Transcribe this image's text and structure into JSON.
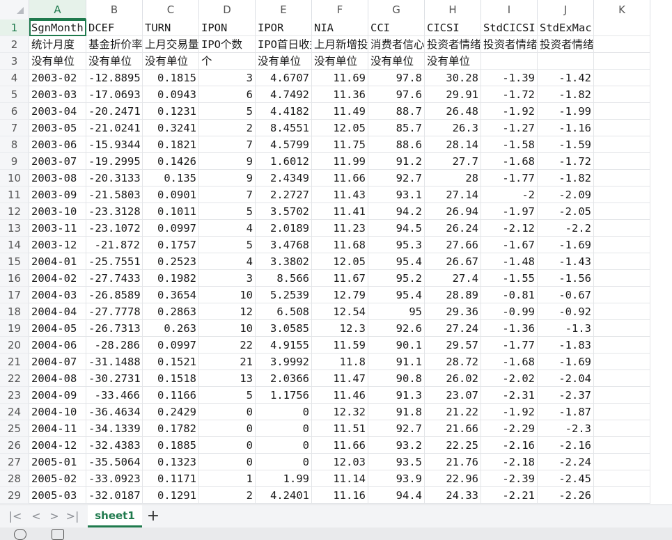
{
  "columns": [
    "A",
    "B",
    "C",
    "D",
    "E",
    "F",
    "G",
    "H",
    "I",
    "J",
    "K"
  ],
  "rows": [
    {
      "n": "1",
      "c": [
        "SgnMonth",
        "DCEF",
        "TURN",
        "IPON",
        "IPOR",
        "NIA",
        "CCI",
        "CICSI",
        "StdCICSI",
        "StdExMacroCICSI",
        ""
      ]
    },
    {
      "n": "2",
      "c": [
        "统计月度",
        "基金折价率",
        "上月交易量",
        "IPO个数",
        "IPO首日收益",
        "上月新增投资",
        "消费者信心指数",
        "投资者情绪",
        "投资者情绪",
        "投资者情绪指数(标准化",
        ""
      ]
    },
    {
      "n": "3",
      "c": [
        "没有单位",
        "没有单位",
        "没有单位",
        "个",
        "没有单位",
        "没有单位",
        "没有单位",
        "没有单位",
        "",
        "",
        ""
      ]
    },
    {
      "n": "4",
      "c": [
        "2003-02",
        "-12.8895",
        "0.1815",
        "3",
        "4.6707",
        "11.69",
        "97.8",
        "30.28",
        "-1.39",
        "-1.42",
        ""
      ]
    },
    {
      "n": "5",
      "c": [
        "2003-03",
        "-17.0693",
        "0.0943",
        "6",
        "4.7492",
        "11.36",
        "97.6",
        "29.91",
        "-1.72",
        "-1.82",
        ""
      ]
    },
    {
      "n": "6",
      "c": [
        "2003-04",
        "-20.2471",
        "0.1231",
        "5",
        "4.4182",
        "11.49",
        "88.7",
        "26.48",
        "-1.92",
        "-1.99",
        ""
      ]
    },
    {
      "n": "7",
      "c": [
        "2003-05",
        "-21.0241",
        "0.3241",
        "2",
        "8.4551",
        "12.05",
        "85.7",
        "26.3",
        "-1.27",
        "-1.16",
        ""
      ]
    },
    {
      "n": "8",
      "c": [
        "2003-06",
        "-15.9344",
        "0.1821",
        "7",
        "4.5799",
        "11.75",
        "88.6",
        "28.14",
        "-1.58",
        "-1.59",
        ""
      ]
    },
    {
      "n": "9",
      "c": [
        "2003-07",
        "-19.2995",
        "0.1426",
        "9",
        "1.6012",
        "11.99",
        "91.2",
        "27.7",
        "-1.68",
        "-1.72",
        ""
      ]
    },
    {
      "n": "10",
      "c": [
        "2003-08",
        "-20.3133",
        "0.135",
        "9",
        "2.4349",
        "11.66",
        "92.7",
        "28",
        "-1.77",
        "-1.82",
        ""
      ]
    },
    {
      "n": "11",
      "c": [
        "2003-09",
        "-21.5803",
        "0.0901",
        "7",
        "2.2727",
        "11.43",
        "93.1",
        "27.14",
        "-2",
        "-2.09",
        ""
      ]
    },
    {
      "n": "12",
      "c": [
        "2003-10",
        "-23.3128",
        "0.1011",
        "5",
        "3.5702",
        "11.41",
        "94.2",
        "26.94",
        "-1.97",
        "-2.05",
        ""
      ]
    },
    {
      "n": "13",
      "c": [
        "2003-11",
        "-23.1072",
        "0.0997",
        "4",
        "2.0189",
        "11.23",
        "94.5",
        "26.24",
        "-2.12",
        "-2.2",
        ""
      ]
    },
    {
      "n": "14",
      "c": [
        "2003-12",
        "-21.872",
        "0.1757",
        "5",
        "3.4768",
        "11.68",
        "95.3",
        "27.66",
        "-1.67",
        "-1.69",
        ""
      ]
    },
    {
      "n": "15",
      "c": [
        "2004-01",
        "-25.7551",
        "0.2523",
        "4",
        "3.3802",
        "12.05",
        "95.4",
        "26.67",
        "-1.48",
        "-1.43",
        ""
      ]
    },
    {
      "n": "16",
      "c": [
        "2004-02",
        "-27.7433",
        "0.1982",
        "3",
        "8.566",
        "11.67",
        "95.2",
        "27.4",
        "-1.55",
        "-1.56",
        ""
      ]
    },
    {
      "n": "17",
      "c": [
        "2004-03",
        "-26.8589",
        "0.3654",
        "10",
        "5.2539",
        "12.79",
        "95.4",
        "28.89",
        "-0.81",
        "-0.67",
        ""
      ]
    },
    {
      "n": "18",
      "c": [
        "2004-04",
        "-27.7778",
        "0.2863",
        "12",
        "6.508",
        "12.54",
        "95",
        "29.36",
        "-0.99",
        "-0.92",
        ""
      ]
    },
    {
      "n": "19",
      "c": [
        "2004-05",
        "-26.7313",
        "0.263",
        "10",
        "3.0585",
        "12.3",
        "92.6",
        "27.24",
        "-1.36",
        "-1.3",
        ""
      ]
    },
    {
      "n": "20",
      "c": [
        "2004-06",
        "-28.286",
        "0.0997",
        "22",
        "4.9155",
        "11.59",
        "90.1",
        "29.57",
        "-1.77",
        "-1.83",
        ""
      ]
    },
    {
      "n": "21",
      "c": [
        "2004-07",
        "-31.1488",
        "0.1521",
        "21",
        "3.9992",
        "11.8",
        "91.1",
        "28.72",
        "-1.68",
        "-1.69",
        ""
      ]
    },
    {
      "n": "22",
      "c": [
        "2004-08",
        "-30.2731",
        "0.1518",
        "13",
        "2.0366",
        "11.47",
        "90.8",
        "26.02",
        "-2.02",
        "-2.04",
        ""
      ]
    },
    {
      "n": "23",
      "c": [
        "2004-09",
        "-33.466",
        "0.1166",
        "5",
        "1.1756",
        "11.46",
        "91.3",
        "23.07",
        "-2.31",
        "-2.37",
        ""
      ]
    },
    {
      "n": "24",
      "c": [
        "2004-10",
        "-36.4634",
        "0.2429",
        "0",
        "0",
        "12.32",
        "91.8",
        "21.22",
        "-1.92",
        "-1.87",
        ""
      ]
    },
    {
      "n": "25",
      "c": [
        "2004-11",
        "-34.1339",
        "0.1782",
        "0",
        "0",
        "11.51",
        "92.7",
        "21.66",
        "-2.29",
        "-2.3",
        ""
      ]
    },
    {
      "n": "26",
      "c": [
        "2004-12",
        "-32.4383",
        "0.1885",
        "0",
        "0",
        "11.66",
        "93.2",
        "22.25",
        "-2.16",
        "-2.16",
        ""
      ]
    },
    {
      "n": "27",
      "c": [
        "2005-01",
        "-35.5064",
        "0.1323",
        "0",
        "0",
        "12.03",
        "93.5",
        "21.76",
        "-2.18",
        "-2.24",
        ""
      ]
    },
    {
      "n": "28",
      "c": [
        "2005-02",
        "-33.0923",
        "0.1171",
        "1",
        "1.99",
        "11.14",
        "93.9",
        "22.96",
        "-2.39",
        "-2.45",
        ""
      ]
    },
    {
      "n": "29",
      "c": [
        "2005-03",
        "-32.0187",
        "0.1291",
        "2",
        "4.2401",
        "11.16",
        "94.4",
        "24.33",
        "-2.21",
        "-2.26",
        ""
      ]
    }
  ],
  "sheet_tab": "sheet1",
  "add_tab": "+",
  "nav": {
    "first": "|<",
    "prev": "<",
    "next": ">",
    "last": ">|"
  }
}
